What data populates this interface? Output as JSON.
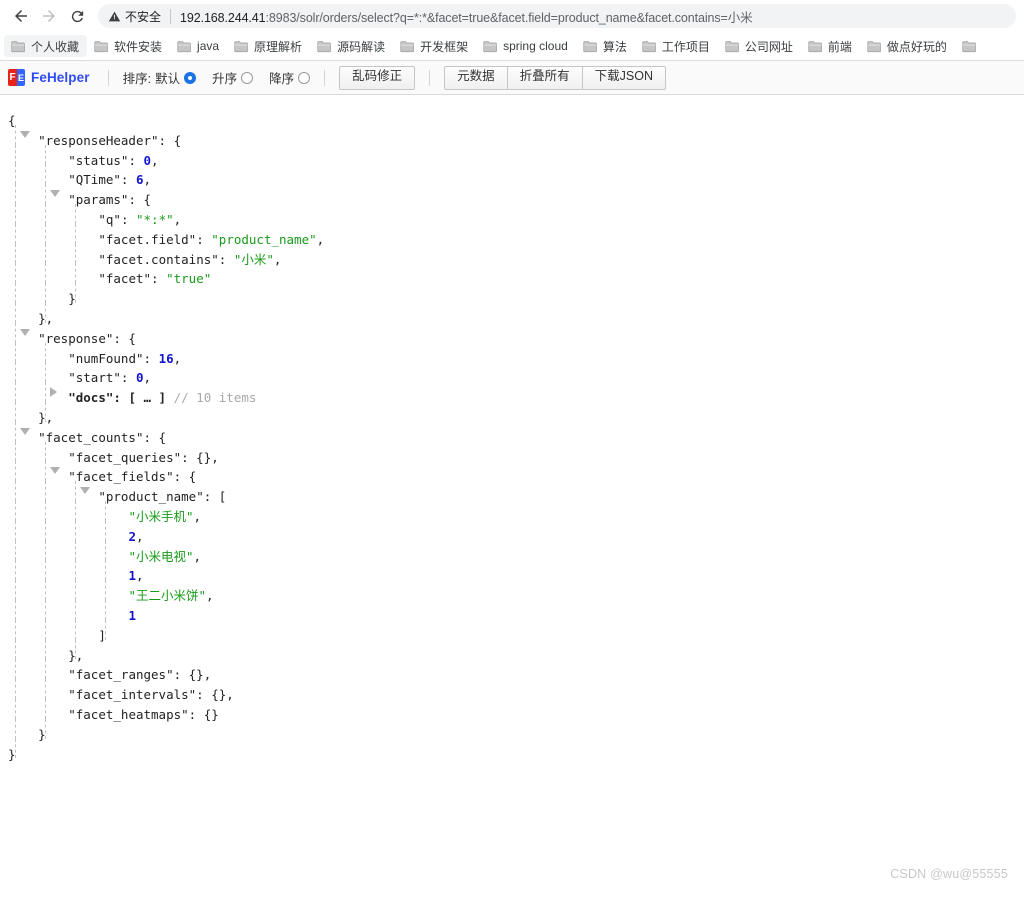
{
  "browser": {
    "back_icon": "arrow-left-icon",
    "forward_icon": "arrow-right-icon",
    "reload_icon": "reload-icon",
    "security": {
      "icon": "warning-triangle-icon",
      "label": "不安全"
    },
    "url": {
      "full": "192.168.244.41:8983/solr/orders/select?q=*:*&facet=true&facet.field=product_name&facet.contains=小米",
      "host": "192.168.244.41",
      "rest": ":8983/solr/orders/select?q=*:*&facet=true&facet.field=product_name&facet.contains=小米"
    },
    "bookmarks": [
      {
        "label": "个人收藏",
        "active": true
      },
      {
        "label": "软件安装",
        "active": false
      },
      {
        "label": "java",
        "active": false
      },
      {
        "label": "原理解析",
        "active": false
      },
      {
        "label": "源码解读",
        "active": false
      },
      {
        "label": "开发框架",
        "active": false
      },
      {
        "label": "spring cloud",
        "active": false
      },
      {
        "label": "算法",
        "active": false
      },
      {
        "label": "工作项目",
        "active": false
      },
      {
        "label": "公司网址",
        "active": false
      },
      {
        "label": "前端",
        "active": false
      },
      {
        "label": "做点好玩的",
        "active": false
      }
    ]
  },
  "fehelper": {
    "brand_name": "FeHelper",
    "brand_color": "#2f4bf5",
    "logo_left_char": "F",
    "logo_right_char": "E",
    "logo_left_color": "#e5231b",
    "logo_right_color": "#3366ff",
    "sort_label": "排序:",
    "sort_options": [
      {
        "label": "默认",
        "checked": true
      },
      {
        "label": "升序",
        "checked": false
      },
      {
        "label": "降序",
        "checked": false
      }
    ],
    "fix_encoding_button": "乱码修正",
    "action_buttons": [
      "元数据",
      "折叠所有",
      "下载JSON"
    ]
  },
  "json_tree": {
    "keys": {
      "responseHeader": "\"responseHeader\"",
      "status": "\"status\"",
      "qtime": "\"QTime\"",
      "params": "\"params\"",
      "q": "\"q\"",
      "facet_field": "\"facet.field\"",
      "facet_contains": "\"facet.contains\"",
      "facet": "\"facet\"",
      "response": "\"response\"",
      "numFound": "\"numFound\"",
      "start": "\"start\"",
      "docs": "\"docs\"",
      "facet_counts": "\"facet_counts\"",
      "facet_queries": "\"facet_queries\"",
      "facet_fields": "\"facet_fields\"",
      "product_name": "\"product_name\"",
      "facet_ranges": "\"facet_ranges\"",
      "facet_intervals": "\"facet_intervals\"",
      "facet_heatmaps": "\"facet_heatmaps\""
    },
    "values": {
      "status": "0",
      "qtime": "6",
      "q": "\"*:*\"",
      "facet_field": "\"product_name\"",
      "facet_contains": "\"小米\"",
      "facet": "\"true\"",
      "numFound": "16",
      "start": "0",
      "docs_collapsed": "[ … ]",
      "docs_comment": "// 10 items",
      "empty_obj": "{}",
      "facet_terms": [
        {
          "term": "\"小米手机\"",
          "count": "2"
        },
        {
          "term": "\"小米电视\"",
          "count": "1"
        },
        {
          "term": "\"王二小米饼\"",
          "count": "1"
        }
      ]
    },
    "punct": {
      "open_brace": "{",
      "close_brace": "}",
      "close_brace_comma": "},",
      "close_bracket": "]",
      "colon": ":",
      "comma": ",",
      "colon_open_brace": ": {",
      "colon_open_bracket": ": [",
      "colon_empty_obj_comma": ": {},",
      "colon_empty_obj": ": {}"
    }
  },
  "watermark": "CSDN @wu@55555"
}
